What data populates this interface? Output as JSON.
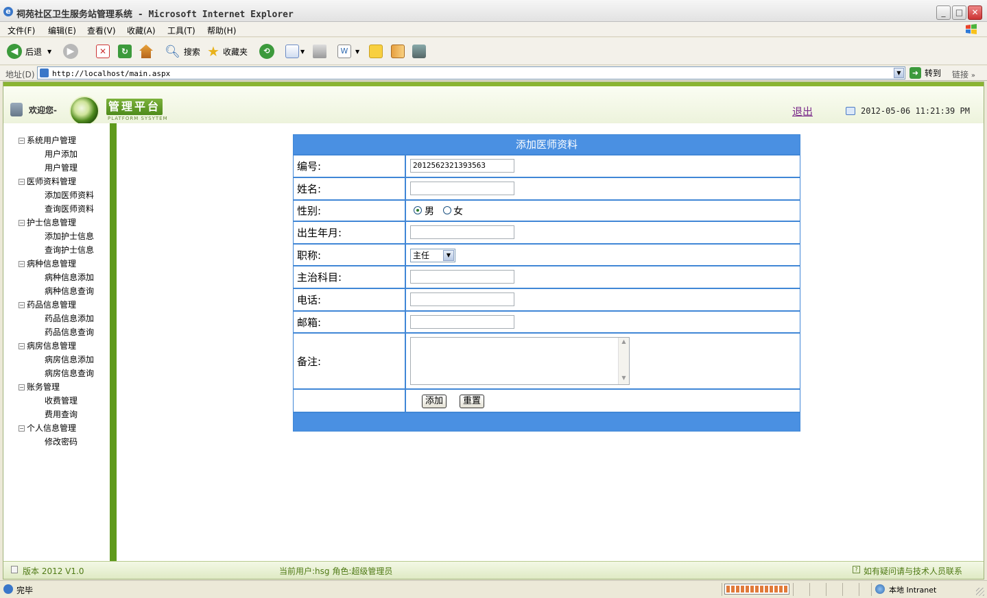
{
  "window": {
    "title": "祠苑社区卫生服务站管理系统 - Microsoft Internet Explorer"
  },
  "menu": [
    "文件(F)",
    "编辑(E)",
    "查看(V)",
    "收藏(A)",
    "工具(T)",
    "帮助(H)"
  ],
  "toolbar": {
    "back": "后退",
    "search": "搜索",
    "favorites": "收藏夹"
  },
  "address": {
    "label": "地址(D)",
    "url": "http://localhost/main.aspx",
    "go": "转到",
    "links": "链接"
  },
  "header": {
    "welcome": "欢迎您-",
    "platform": "管理平台",
    "platform_sub": "PLATFORM SYSYTEM",
    "logout": "退出",
    "datetime": "2012-05-06 11:21:39 PM"
  },
  "nav": [
    {
      "label": "系统用户管理",
      "children": [
        "用户添加",
        "用户管理"
      ]
    },
    {
      "label": "医师资料管理",
      "children": [
        "添加医师资料",
        "查询医师资料"
      ]
    },
    {
      "label": "护士信息管理",
      "children": [
        "添加护士信息",
        "查询护士信息"
      ]
    },
    {
      "label": "病种信息管理",
      "children": [
        "病种信息添加",
        "病种信息查询"
      ]
    },
    {
      "label": "药品信息管理",
      "children": [
        "药品信息添加",
        "药品信息查询"
      ]
    },
    {
      "label": "病房信息管理",
      "children": [
        "病房信息添加",
        "病房信息查询"
      ]
    },
    {
      "label": "账务管理",
      "children": [
        "收费管理",
        "费用查询"
      ]
    },
    {
      "label": "个人信息管理",
      "children": [
        "修改密码"
      ]
    }
  ],
  "form": {
    "title": "添加医师资料",
    "id_label": "编号:",
    "id_value": "2012562321393563",
    "name_label": "姓名:",
    "gender_label": "性别:",
    "gender_male": "男",
    "gender_female": "女",
    "birth_label": "出生年月:",
    "title_label": "职称:",
    "title_value": "主任",
    "dept_label": "主治科目:",
    "phone_label": "电话:",
    "email_label": "邮箱:",
    "note_label": "备注:",
    "add_btn": "添加",
    "reset_btn": "重置"
  },
  "footer": {
    "version": "版本 2012 V1.0",
    "user": "当前用户:hsg 角色:超级管理员",
    "contact": "如有疑问请与技术人员联系"
  },
  "status": {
    "text": "完毕",
    "zone": "本地 Intranet"
  }
}
